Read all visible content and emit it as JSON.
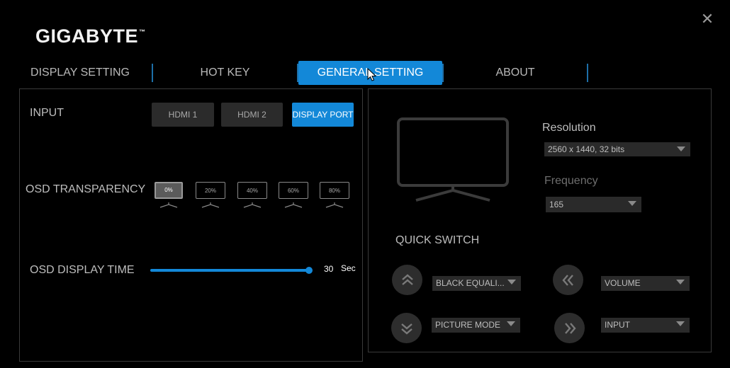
{
  "brand": "GIGABYTE",
  "tabs": [
    "DISPLAY SETTING",
    "HOT KEY",
    "GENERAL SETTING",
    "ABOUT"
  ],
  "active_tab": "GENERAL SETTING",
  "input": {
    "label": "INPUT",
    "options": [
      "HDMI 1",
      "HDMI 2",
      "DISPLAY PORT"
    ],
    "selected": "DISPLAY PORT"
  },
  "osd_transparency": {
    "label": "OSD TRANSPARENCY",
    "options": [
      "0%",
      "20%",
      "40%",
      "60%",
      "80%"
    ],
    "selected": "0%"
  },
  "osd_display_time": {
    "label": "OSD DISPLAY TIME",
    "value": "30",
    "unit": "Sec",
    "level": 1.0
  },
  "resolution": {
    "label": "Resolution",
    "value": "2560 x 1440, 32 bits"
  },
  "frequency": {
    "label": "Frequency",
    "value": "165"
  },
  "quick_switch": {
    "label": "QUICK SWITCH",
    "up": "BLACK EQUALI...",
    "down": "PICTURE MODE",
    "left": "VOLUME",
    "right": "INPUT"
  },
  "colors": {
    "accent": "#1388d8",
    "background": "#000000",
    "panel_border": "#3a3a3a"
  },
  "icons": [
    "close-icon",
    "chevron-double-up-icon",
    "chevron-double-down-icon",
    "chevron-double-left-icon",
    "chevron-double-right-icon",
    "monitor-icon",
    "mouse-cursor-icon"
  ]
}
